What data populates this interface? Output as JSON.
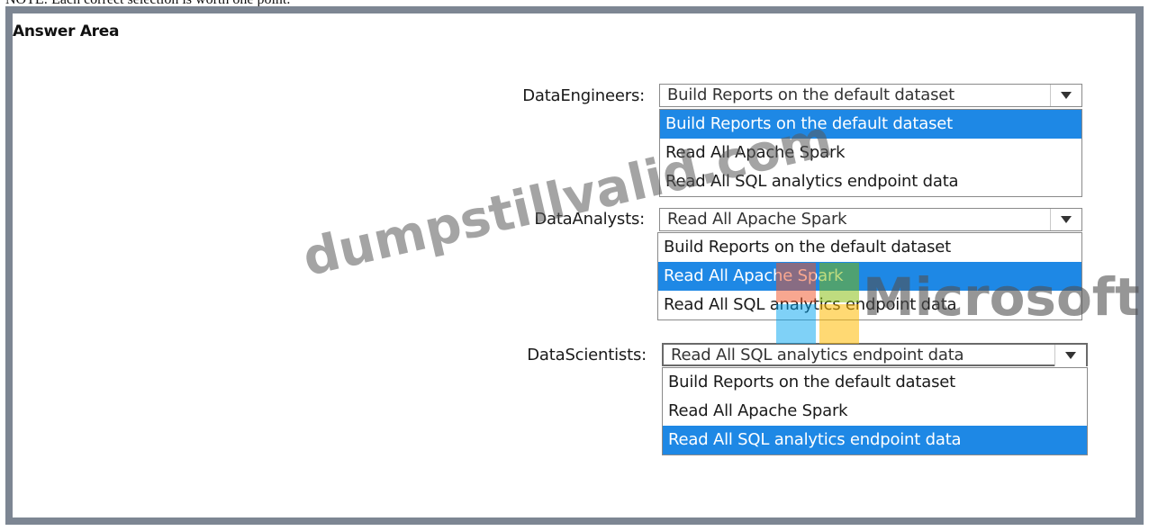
{
  "top_note": "NOTE: Each correct selection is worth one point.",
  "answer_area": {
    "title": "Answer Area"
  },
  "rows": [
    {
      "label": "DataEngineers:",
      "selected": "Build Reports on the default dataset",
      "options": [
        "Build Reports on the default dataset",
        "Read All Apache Spark",
        "Read All SQL analytics endpoint data"
      ],
      "selected_index": 0
    },
    {
      "label": "DataAnalysts:",
      "selected": "Read All Apache Spark",
      "options": [
        "Build Reports on the default dataset",
        "Read All Apache Spark",
        "Read All SQL analytics endpoint data"
      ],
      "selected_index": 1
    },
    {
      "label": "DataScientists:",
      "selected": "Read All SQL analytics endpoint data",
      "options": [
        "Build Reports on the default dataset",
        "Read All Apache Spark",
        "Read All SQL analytics endpoint data"
      ],
      "selected_index": 2
    }
  ],
  "watermark": {
    "left_text": "dumpstillvalid.com",
    "right_text": "Microsoft"
  },
  "colors": {
    "selection": "#1e88e5",
    "frame": "#7d8693",
    "logo_red": "#f25022",
    "logo_green": "#7fba00",
    "logo_blue": "#00a4ef",
    "logo_yellow": "#ffb900"
  }
}
